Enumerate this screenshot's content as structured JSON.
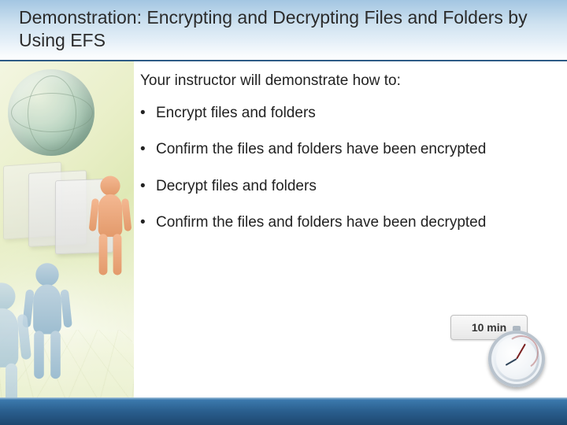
{
  "title": "Demonstration: Encrypting and Decrypting Files and Folders by Using EFS",
  "intro": "Your instructor will demonstrate how to:",
  "bullets": [
    "Encrypt files and folders",
    "Confirm the files and folders have been encrypted",
    "Decrypt files and folders",
    "Confirm the files and folders have been decrypted"
  ],
  "timer_label": "10 min"
}
